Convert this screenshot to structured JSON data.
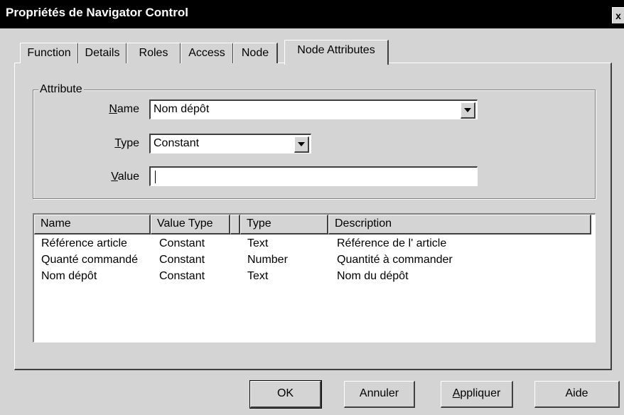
{
  "window": {
    "title": "Propriétés de Navigator Control",
    "close_label": "x"
  },
  "tabs": [
    {
      "label": "Function"
    },
    {
      "label": "Details"
    },
    {
      "label": "Roles"
    },
    {
      "label": "Access"
    },
    {
      "label": "Node"
    },
    {
      "label": "Node Attributes",
      "active": true
    }
  ],
  "attribute_group": {
    "legend": "Attribute",
    "name": {
      "label_mnemonic": "N",
      "label_rest": "ame",
      "value": "Nom dépôt"
    },
    "type": {
      "label_mnemonic": "T",
      "label_rest": "ype",
      "value": "Constant"
    },
    "value": {
      "label_mnemonic": "V",
      "label_rest": "alue",
      "value": ""
    }
  },
  "list": {
    "columns": [
      "Name",
      "Value Type",
      "Type",
      "Description"
    ],
    "rows": [
      [
        "Référence article",
        "Constant",
        "Text",
        "Référence de l' article"
      ],
      [
        "Quanté commandé",
        "Constant",
        "Number",
        "Quantité à commander"
      ],
      [
        "Nom dépôt",
        "Constant",
        "Text",
        "Nom du dépôt"
      ]
    ]
  },
  "buttons": {
    "ok": "OK",
    "cancel": "Annuler",
    "apply_mnemonic": "A",
    "apply_rest": "ppliquer",
    "help": "Aide"
  }
}
